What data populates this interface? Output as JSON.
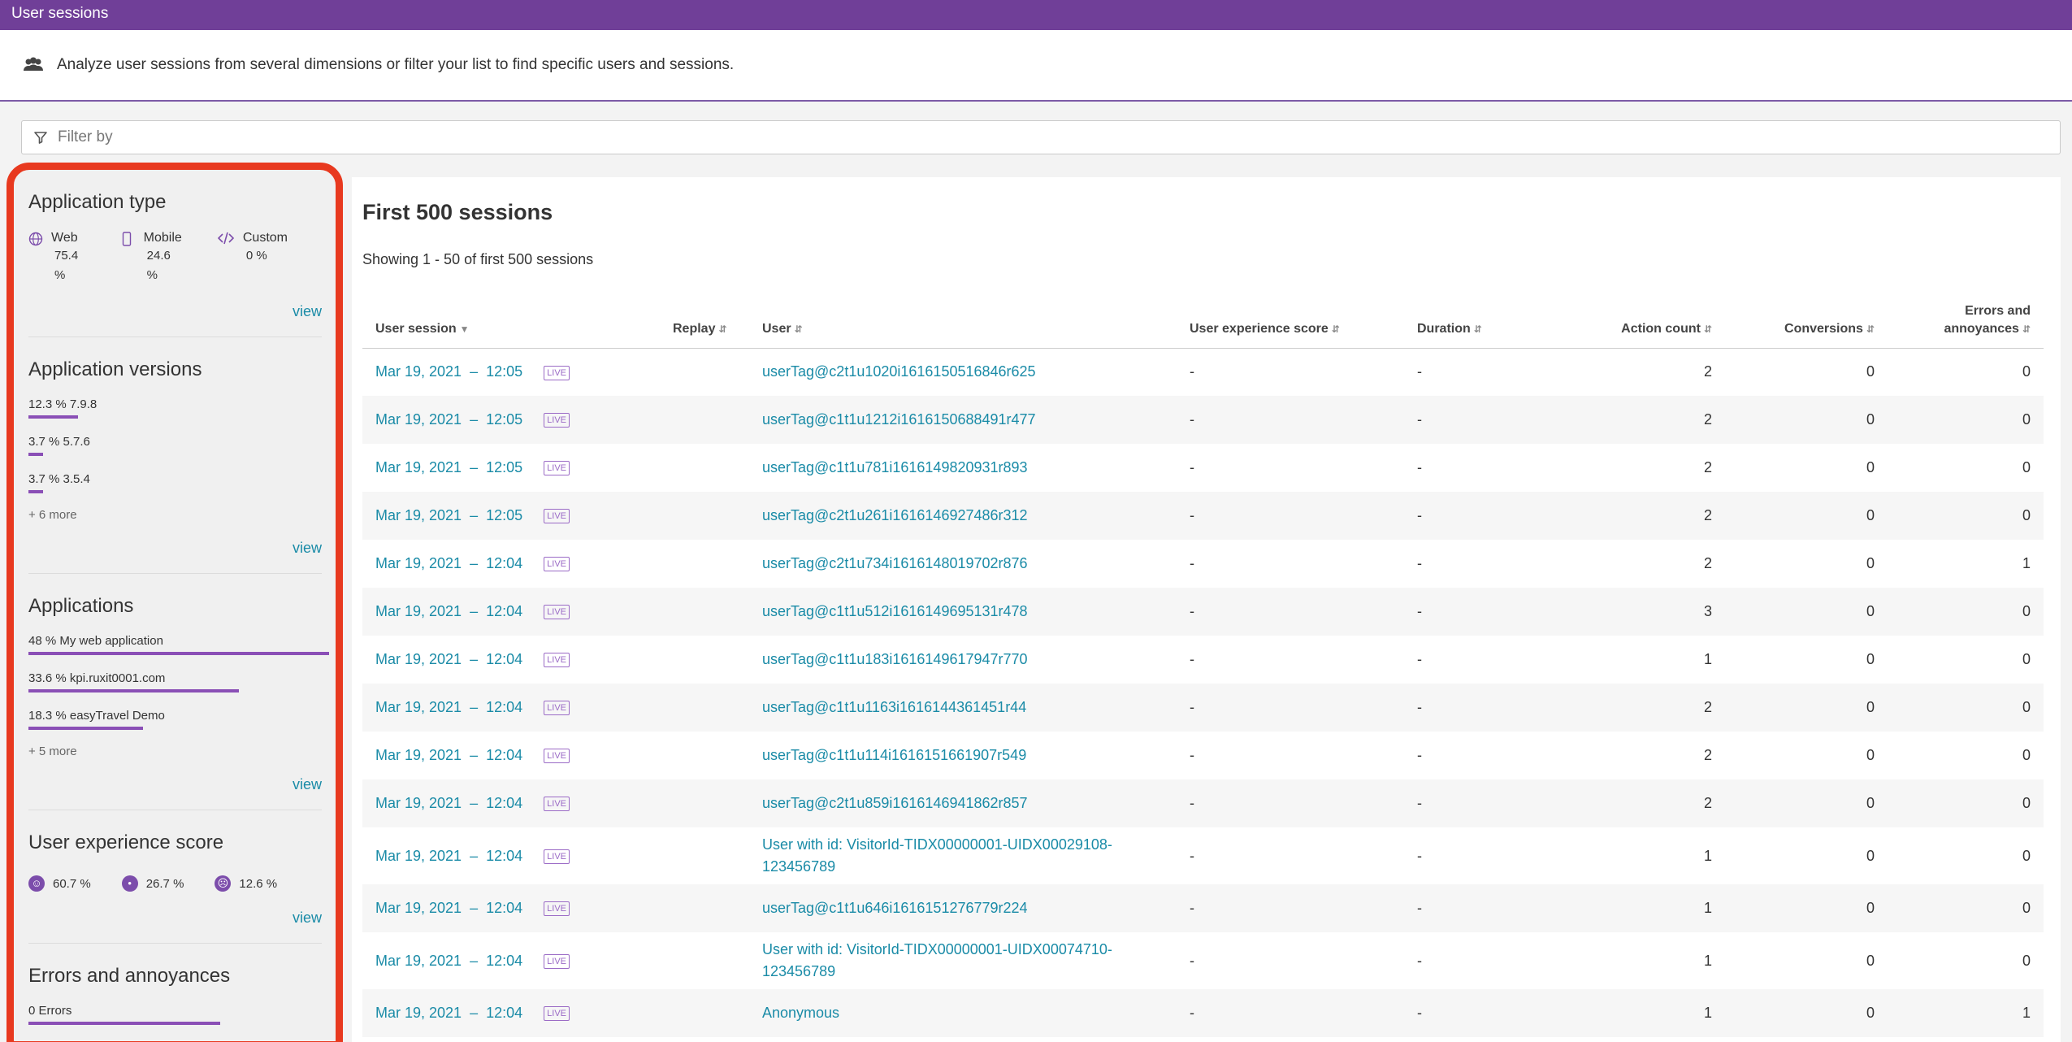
{
  "header": {
    "title": "User sessions"
  },
  "intro": {
    "text": "Analyze user sessions from several dimensions or filter your list to find specific users and sessions."
  },
  "filter": {
    "placeholder": "Filter by"
  },
  "sidebar": {
    "app_type": {
      "title": "Application type",
      "items": [
        {
          "name": "Web",
          "value": "75.4 %",
          "icon": "globe-icon"
        },
        {
          "name": "Mobile",
          "value": "24.6 %",
          "icon": "mobile-icon"
        },
        {
          "name": "Custom",
          "value": "0 %",
          "icon": "code-icon"
        }
      ],
      "view": "view"
    },
    "app_versions": {
      "title": "Application versions",
      "items": [
        {
          "label": "12.3 % 7.9.8",
          "pct": 12.3
        },
        {
          "label": "3.7 % 5.7.6",
          "pct": 3.7
        },
        {
          "label": "3.7 % 3.5.4",
          "pct": 3.7
        }
      ],
      "more": "+ 6 more",
      "view": "view"
    },
    "applications": {
      "title": "Applications",
      "items": [
        {
          "label": "48 % My web application",
          "pct": 48
        },
        {
          "label": "33.6 % kpi.ruxit0001.com",
          "pct": 33.6
        },
        {
          "label": "18.3 % easyTravel Demo",
          "pct": 18.3
        }
      ],
      "more": "+ 5 more",
      "view": "view"
    },
    "ux_score": {
      "title": "User experience score",
      "items": [
        {
          "value": "60.7 %",
          "icon": "satisfied-face-icon",
          "glyph": "☺"
        },
        {
          "value": "26.7 %",
          "icon": "tolerating-face-icon",
          "glyph": "•"
        },
        {
          "value": "12.6 %",
          "icon": "frustrated-face-icon",
          "glyph": "☹"
        }
      ],
      "view": "view"
    },
    "errors": {
      "title": "Errors and annoyances",
      "items": [
        {
          "label": "0 Errors"
        }
      ]
    }
  },
  "main": {
    "title": "First 500 sessions",
    "showing": "Showing 1 - 50 of first 500 sessions",
    "columns": {
      "session": "User session",
      "replay": "Replay",
      "user": "User",
      "ux": "User experience score",
      "duration": "Duration",
      "actions": "Action count",
      "conversions": "Conversions",
      "errors_l1": "Errors and",
      "errors_l2": "annoyances"
    },
    "live_label": "LIVE",
    "rows": [
      {
        "date": "Mar 19, 2021",
        "time": "12:05",
        "user": "userTag@c2t1u1020i1616150516846r625",
        "ux": "-",
        "duration": "-",
        "actions": "2",
        "conversions": "0",
        "errors": "0"
      },
      {
        "date": "Mar 19, 2021",
        "time": "12:05",
        "user": "userTag@c1t1u1212i1616150688491r477",
        "ux": "-",
        "duration": "-",
        "actions": "2",
        "conversions": "0",
        "errors": "0"
      },
      {
        "date": "Mar 19, 2021",
        "time": "12:05",
        "user": "userTag@c1t1u781i1616149820931r893",
        "ux": "-",
        "duration": "-",
        "actions": "2",
        "conversions": "0",
        "errors": "0"
      },
      {
        "date": "Mar 19, 2021",
        "time": "12:05",
        "user": "userTag@c2t1u261i1616146927486r312",
        "ux": "-",
        "duration": "-",
        "actions": "2",
        "conversions": "0",
        "errors": "0"
      },
      {
        "date": "Mar 19, 2021",
        "time": "12:04",
        "user": "userTag@c2t1u734i1616148019702r876",
        "ux": "-",
        "duration": "-",
        "actions": "2",
        "conversions": "0",
        "errors": "1"
      },
      {
        "date": "Mar 19, 2021",
        "time": "12:04",
        "user": "userTag@c1t1u512i1616149695131r478",
        "ux": "-",
        "duration": "-",
        "actions": "3",
        "conversions": "0",
        "errors": "0"
      },
      {
        "date": "Mar 19, 2021",
        "time": "12:04",
        "user": "userTag@c1t1u183i1616149617947r770",
        "ux": "-",
        "duration": "-",
        "actions": "1",
        "conversions": "0",
        "errors": "0"
      },
      {
        "date": "Mar 19, 2021",
        "time": "12:04",
        "user": "userTag@c1t1u1163i1616144361451r44",
        "ux": "-",
        "duration": "-",
        "actions": "2",
        "conversions": "0",
        "errors": "0"
      },
      {
        "date": "Mar 19, 2021",
        "time": "12:04",
        "user": "userTag@c1t1u114i1616151661907r549",
        "ux": "-",
        "duration": "-",
        "actions": "2",
        "conversions": "0",
        "errors": "0"
      },
      {
        "date": "Mar 19, 2021",
        "time": "12:04",
        "user": "userTag@c2t1u859i1616146941862r857",
        "ux": "-",
        "duration": "-",
        "actions": "2",
        "conversions": "0",
        "errors": "0"
      },
      {
        "date": "Mar 19, 2021",
        "time": "12:04",
        "user": "User with id: VisitorId-TIDX00000001-UIDX00029108-",
        "user2": "123456789",
        "ux": "-",
        "duration": "-",
        "actions": "1",
        "conversions": "0",
        "errors": "0"
      },
      {
        "date": "Mar 19, 2021",
        "time": "12:04",
        "user": "userTag@c1t1u646i1616151276779r224",
        "ux": "-",
        "duration": "-",
        "actions": "1",
        "conversions": "0",
        "errors": "0"
      },
      {
        "date": "Mar 19, 2021",
        "time": "12:04",
        "user": "User with id: VisitorId-TIDX00000001-UIDX00074710-",
        "user2": "123456789",
        "ux": "-",
        "duration": "-",
        "actions": "1",
        "conversions": "0",
        "errors": "0"
      },
      {
        "date": "Mar 19, 2021",
        "time": "12:04",
        "user": "Anonymous",
        "ux": "-",
        "duration": "-",
        "actions": "1",
        "conversions": "0",
        "errors": "1"
      }
    ]
  }
}
